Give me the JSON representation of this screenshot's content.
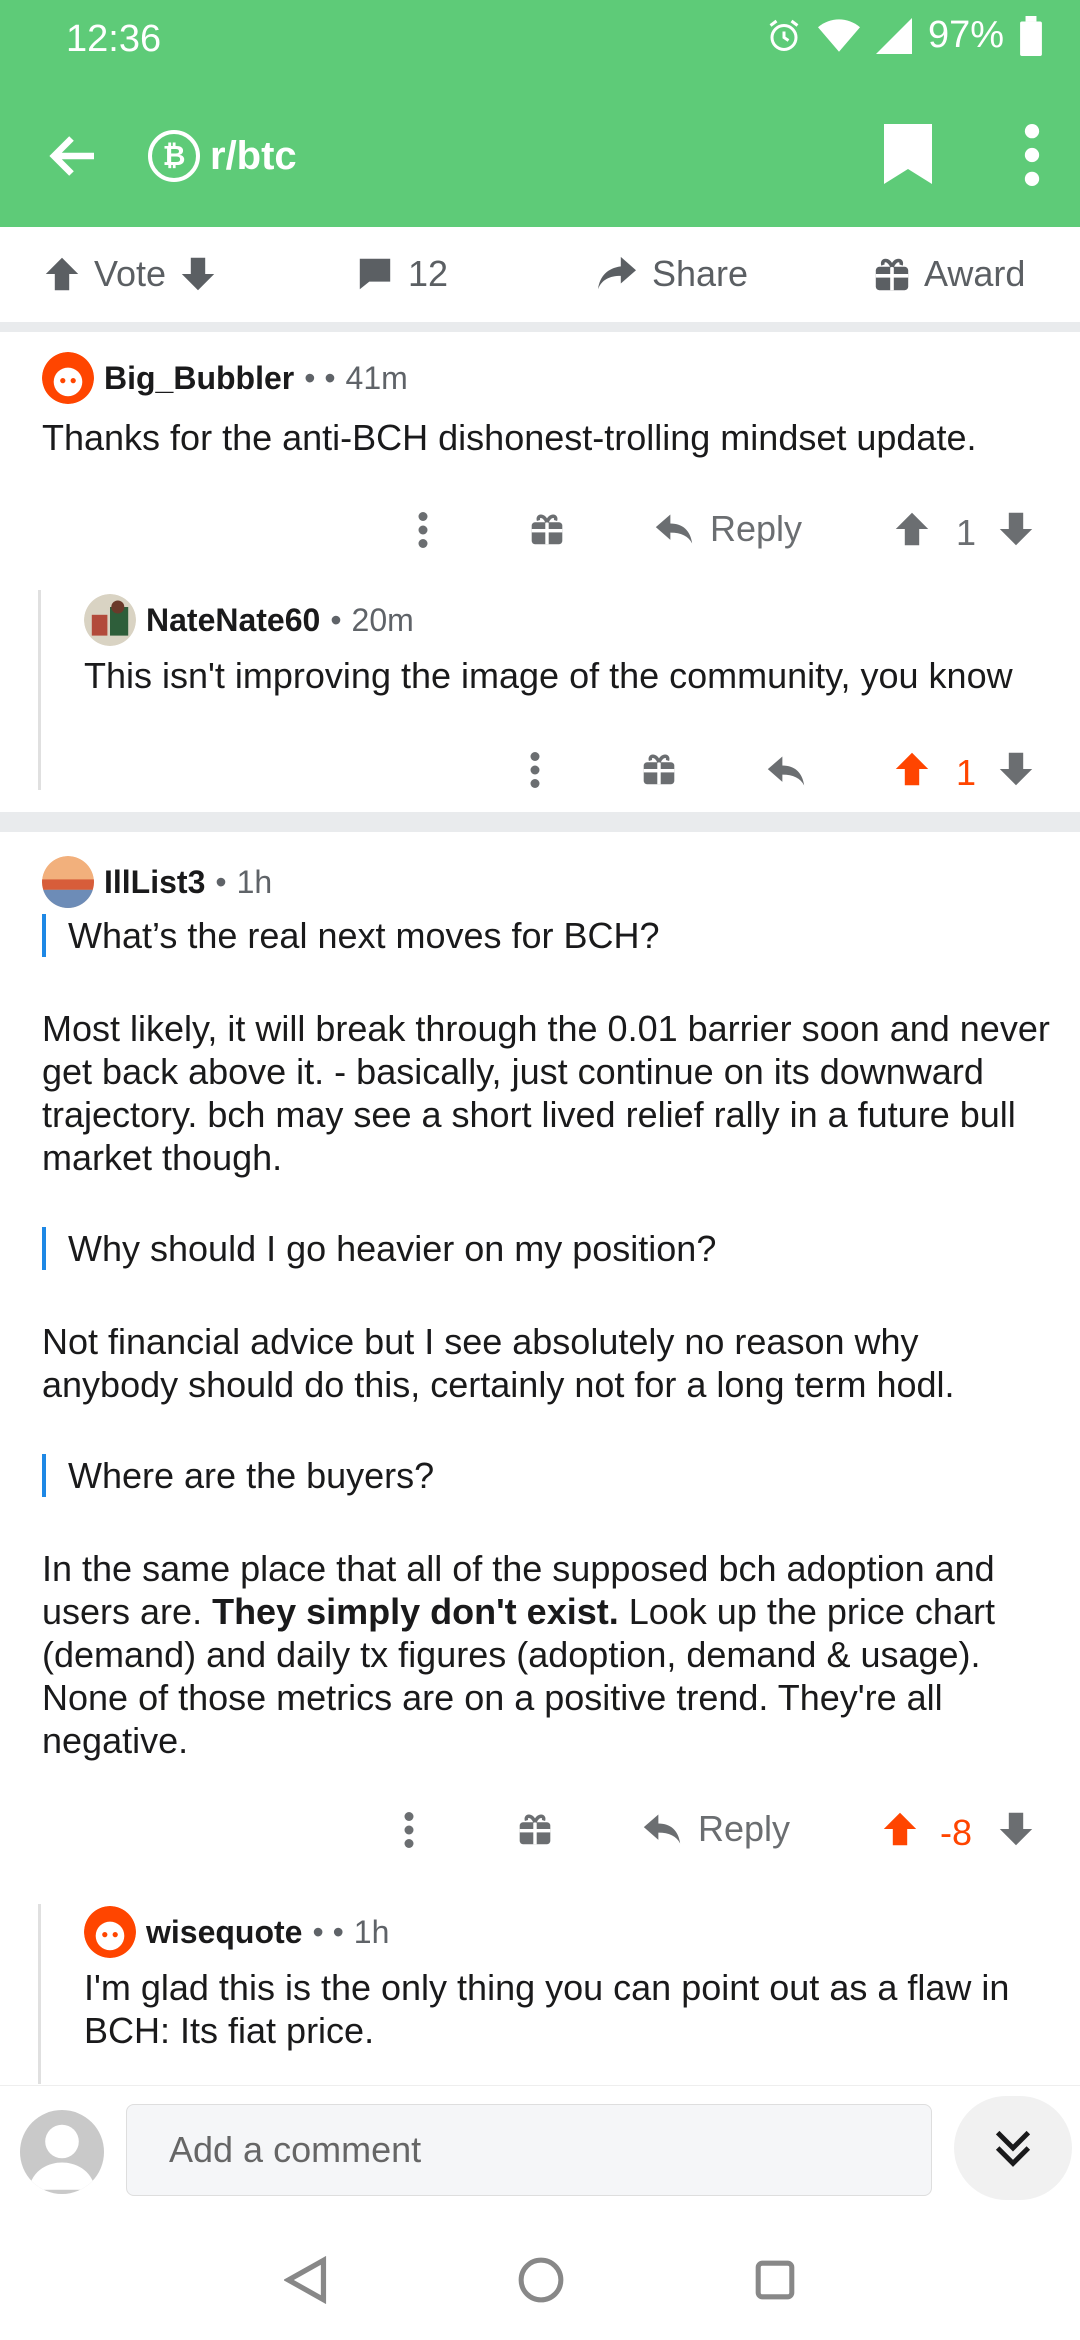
{
  "status": {
    "time": "12:36",
    "battery": "97%"
  },
  "header": {
    "subreddit": "r/btc"
  },
  "post_actions": {
    "vote": "Vote",
    "comments_count": "12",
    "share": "Share",
    "award": "Award"
  },
  "comments": [
    {
      "author": "Big_Bubbler",
      "time": "41m",
      "text": "Thanks for the anti-BCH dishonest-trolling mindset update.",
      "reply_label": "Reply",
      "score": "1"
    },
    {
      "author": "NateNate60",
      "time": "20m",
      "text": "This isn't improving the image of the community, you know",
      "score": "1"
    },
    {
      "author": "IllList3",
      "time": "1h",
      "quote1": "What’s the real next moves for BCH?",
      "para1": "Most likely,  it will break through the 0.01 barrier soon and never get back above it.  - basically,  just continue on its downward trajectory.  bch may see a short lived relief rally in a future bull market though.",
      "quote2": "Why should I go heavier on my position?",
      "para2": "Not financial advice but I see absolutely no reason why anybody should do this, certainly not for a long term hodl.",
      "quote3": "Where are the buyers?",
      "para3_start": "In the same place that all of the supposed bch adoption and users are.  ",
      "para3_bold": "They simply don't exist.",
      "para3_end": "  Look up the price chart (demand) and daily tx figures (adoption, demand & usage).  None of those metrics are on a positive trend.  They're all negative.",
      "reply_label": "Reply",
      "score": "-8"
    },
    {
      "author": "wisequote",
      "time": "1h",
      "text": "I'm glad this is the only thing you can point out as a flaw in BCH: Its fiat price."
    }
  ],
  "composer": {
    "placeholder": "Add a comment"
  },
  "colors": {
    "brand": "#5ecb78",
    "upvote": "#ff4500",
    "quote": "#1e88e5"
  }
}
